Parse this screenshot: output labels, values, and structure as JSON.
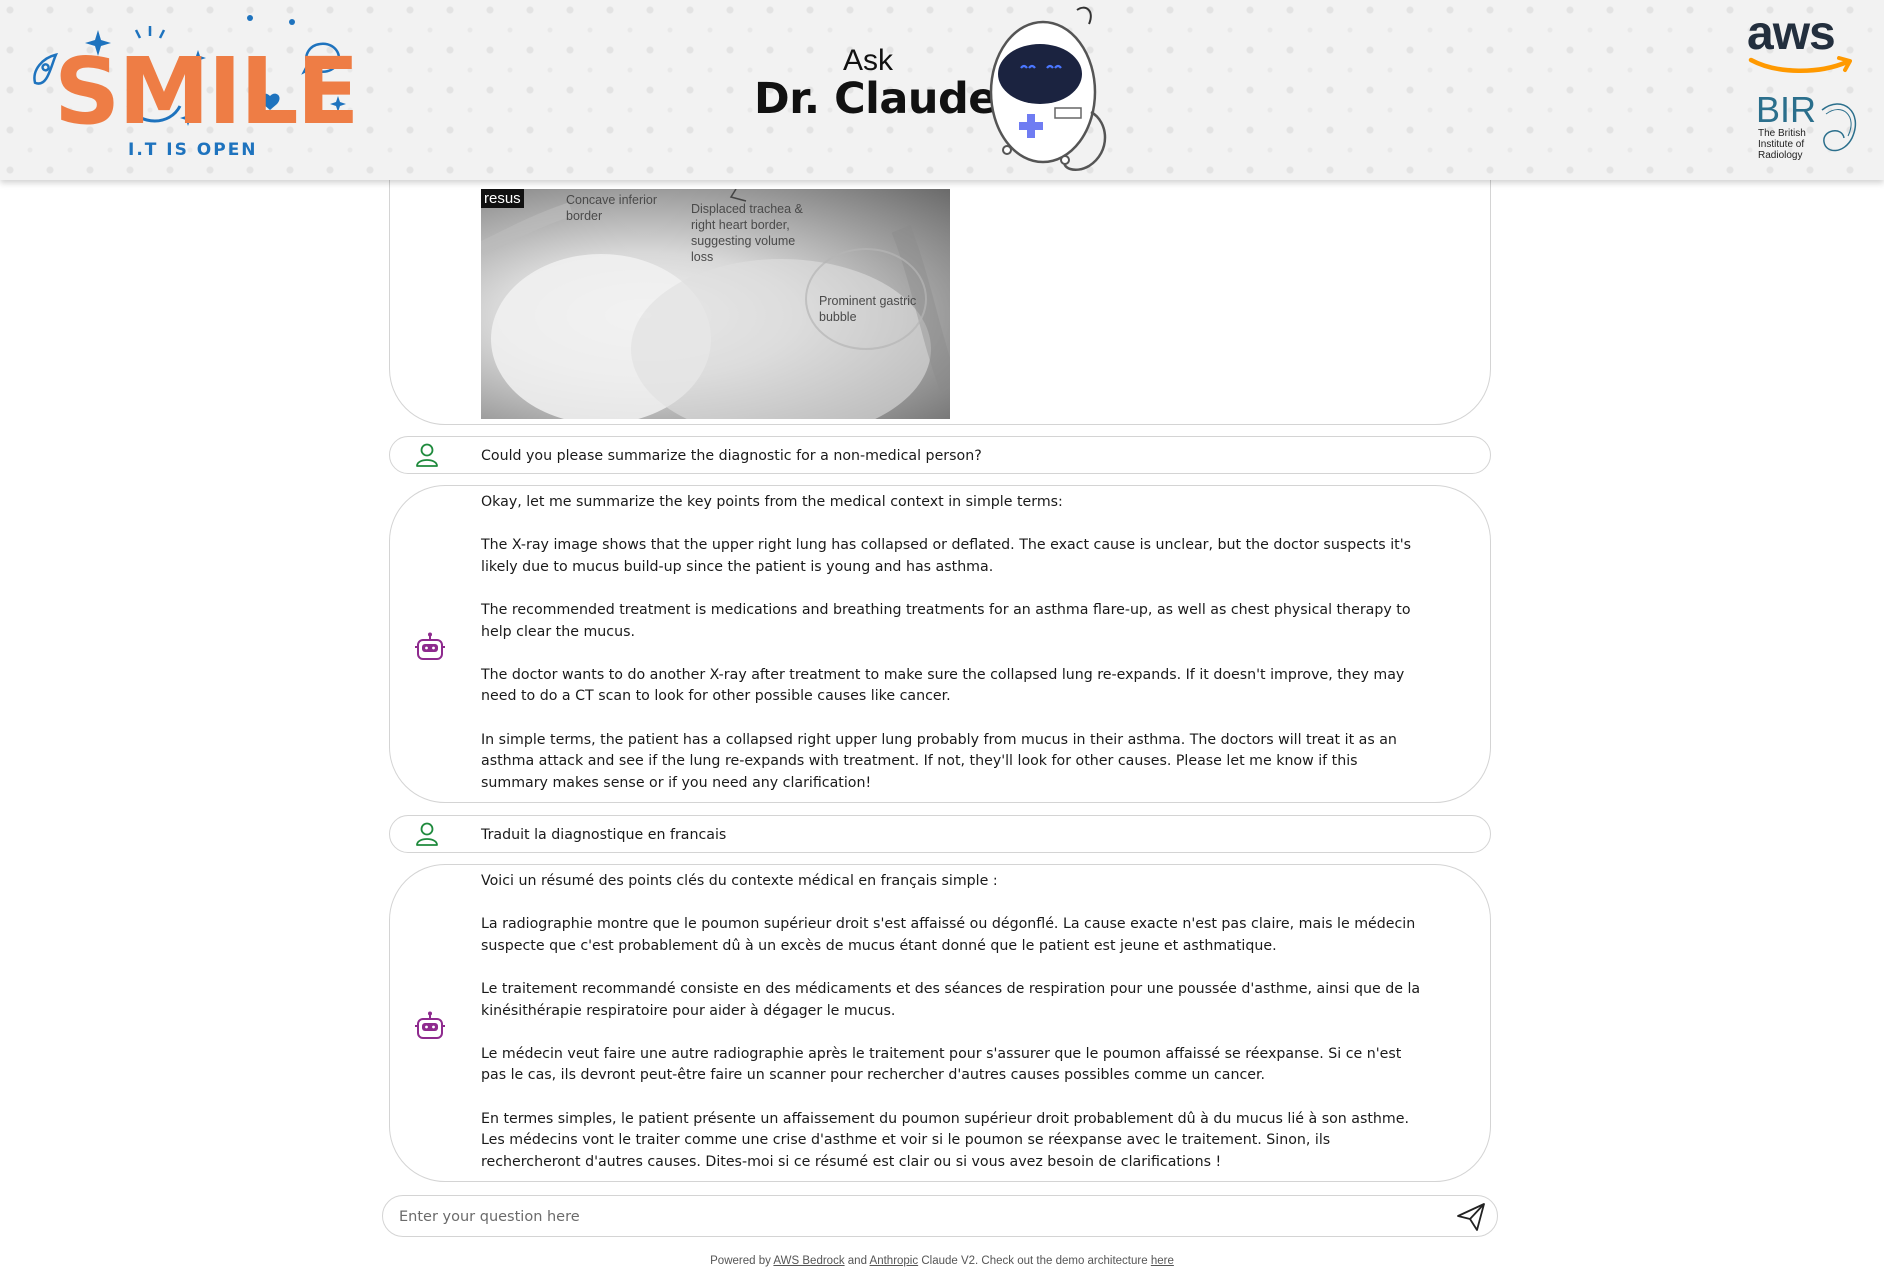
{
  "header": {
    "logo_word": "SMILE",
    "logo_tagline": "I.T IS OPEN",
    "title_small": "Ask",
    "title_big": "Dr. Claude",
    "aws_word": "aws",
    "bir_word": "BIR",
    "bir_subtitle": "The British Institute of Radiology"
  },
  "image_message": {
    "badge": "resus",
    "annotations": {
      "concave": "Concave inferior border",
      "trachea": "Displaced trachea & right heart border, suggesting volume loss",
      "gastric": "Prominent gastric bubble"
    }
  },
  "messages": [
    {
      "role": "user",
      "icon": "user-icon",
      "text": "Could you please summarize the diagnostic for a non-medical person?"
    },
    {
      "role": "assistant",
      "icon": "robot-icon",
      "paragraphs": [
        " Okay, let me summarize the key points from the medical context in simple terms:",
        "The X-ray image shows that the upper right lung has collapsed or deflated. The exact cause is unclear, but the doctor suspects it's likely due to mucus build-up since the patient is young and has asthma.",
        "The recommended treatment is medications and breathing treatments for an asthma flare-up, as well as chest physical therapy to help clear the mucus.",
        "The doctor wants to do another X-ray after treatment to make sure the collapsed lung re-expands. If it doesn't improve, they may need to do a CT scan to look for other possible causes like cancer.",
        "In simple terms, the patient has a collapsed right upper lung probably from mucus in their asthma. The doctors will treat it as an asthma attack and see if the lung re-expands with treatment. If not, they'll look for other causes. Please let me know if this summary makes sense or if you need any clarification!"
      ]
    },
    {
      "role": "user",
      "icon": "user-icon",
      "text": "Traduit la diagnostique en francais"
    },
    {
      "role": "assistant",
      "icon": "robot-icon",
      "paragraphs": [
        " Voici un résumé des points clés du contexte médical en français simple :",
        "La radiographie montre que le poumon supérieur droit s'est affaissé ou dégonflé. La cause exacte n'est pas claire, mais le médecin suspecte que c'est probablement dû à un excès de mucus étant donné que le patient est jeune et asthmatique.",
        "Le traitement recommandé consiste en des médicaments et des séances de respiration pour une poussée d'asthme, ainsi que de la kinésithérapie respiratoire pour aider à dégager le mucus.",
        "Le médecin veut faire une autre radiographie après le traitement pour s'assurer que le poumon affaissé se réexpanse. Si ce n'est pas le cas, ils devront peut-être faire un scanner pour rechercher d'autres causes possibles comme un cancer.",
        "En termes simples, le patient présente un affaissement du poumon supérieur droit probablement dû à du mucus lié à son asthme. Les médecins vont le traiter comme une crise d'asthme et voir si le poumon se réexpanse avec le traitement. Sinon, ils rechercheront d'autres causes. Dites-moi si ce résumé est clair ou si vous avez besoin de clarifications !"
      ]
    }
  ],
  "input": {
    "placeholder": "Enter your question here",
    "value": "",
    "send_icon": "send-icon"
  },
  "footer": {
    "prefix": "Powered by",
    "link1": "AWS Bedrock",
    "and": "and",
    "link2": "Anthropic",
    "middle": "Claude V2. Check out the demo architecture",
    "link3": "here"
  },
  "colors": {
    "accent_orange": "#ee7d45",
    "accent_blue": "#1e73be",
    "user_icon": "#1e8a3c",
    "robot_icon": "#8e2a8e",
    "bubble_border": "#d4d4d4"
  }
}
